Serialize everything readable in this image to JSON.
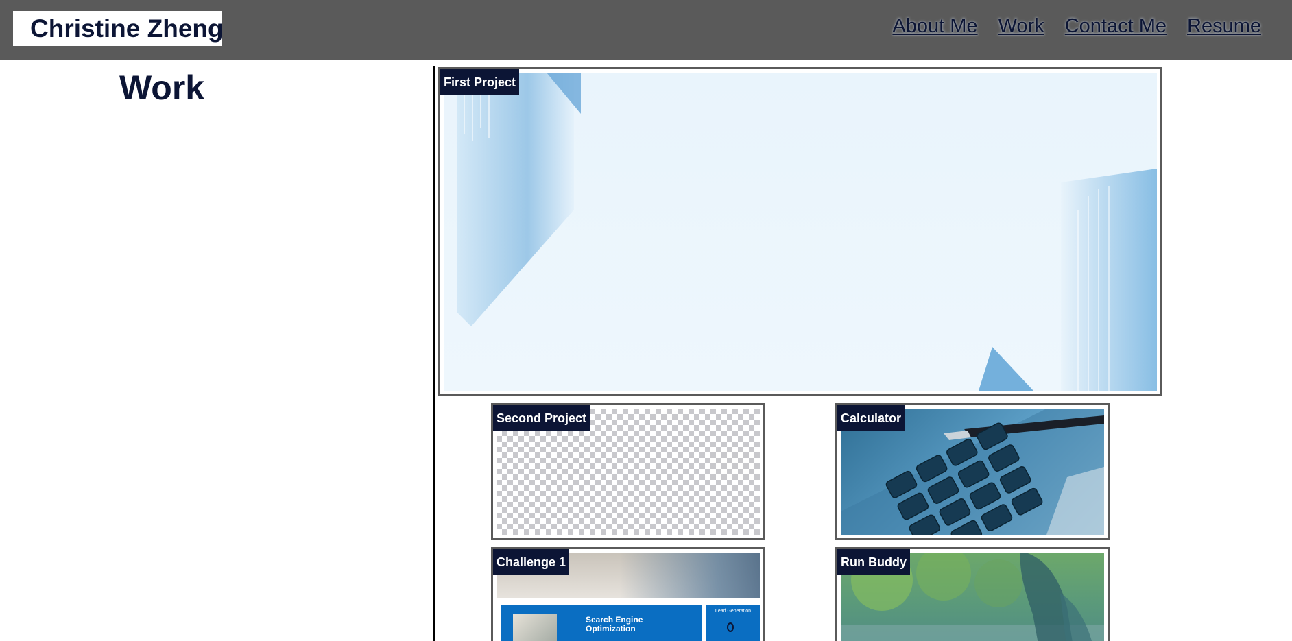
{
  "header": {
    "brand": "Christine Zheng",
    "nav": [
      {
        "label": "About Me"
      },
      {
        "label": "Work"
      },
      {
        "label": "Contact Me"
      },
      {
        "label": "Resume"
      }
    ]
  },
  "main": {
    "section_title": "Work",
    "projects": [
      {
        "label": "First Project",
        "image": "abstract-blue-background-image"
      },
      {
        "label": "Second Project",
        "image": "transparent-placeholder-image"
      },
      {
        "label": "Calculator",
        "image": "calculator-keypad-image"
      },
      {
        "label": "Challenge 1",
        "image": "seo-webpage-screenshot-image",
        "thumb_text": {
          "heading": "Search Engine Optimization",
          "side": "Lead Generation"
        }
      },
      {
        "label": "Run Buddy",
        "image": "runner-tying-shoe-image"
      }
    ]
  },
  "colors": {
    "header_bg": "#5a5a5a",
    "accent_navy": "#0c1535",
    "card_border": "#5a5a5a",
    "seo_blue": "#0a6ec2"
  }
}
